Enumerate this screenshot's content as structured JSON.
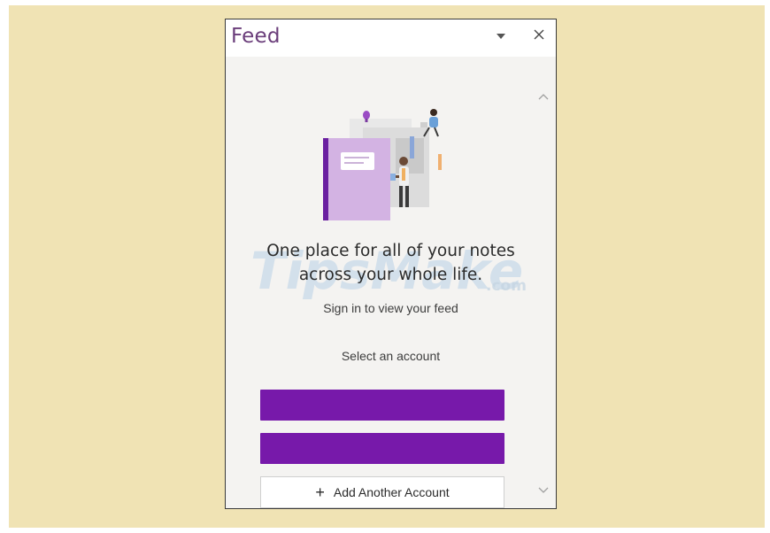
{
  "pane": {
    "title": "Feed",
    "dropdown_icon": "chevron-down-icon",
    "close_icon": "close-icon"
  },
  "content": {
    "headline_line1": "One place for all of your notes",
    "headline_line2": "across your whole life.",
    "subtext": "Sign in to view your feed",
    "select_label": "Select an account",
    "account_buttons": [
      "",
      ""
    ],
    "add_account_label": "Add Another Account",
    "add_account_icon": "plus-icon"
  },
  "watermark": {
    "text": "TipsMake",
    "suffix": ".com"
  },
  "colors": {
    "backdrop": "#f0e3b4",
    "accent": "#7719aa",
    "title": "#6a3d7a"
  }
}
